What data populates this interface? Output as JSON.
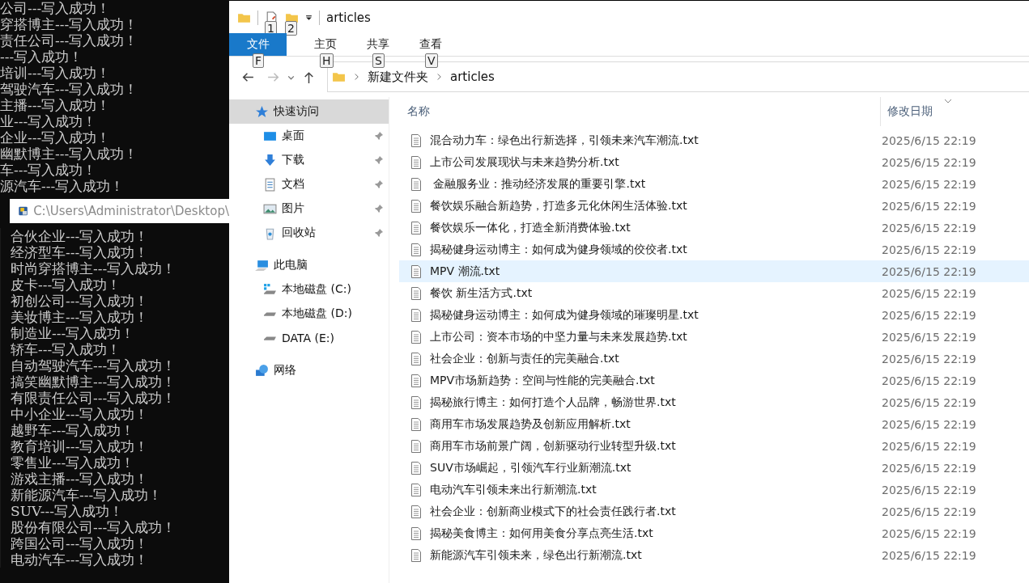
{
  "console": {
    "lines_top": [
      "公司---写入成功！",
      "穿搭博主---写入成功！",
      "责任公司---写入成功！",
      "---写入成功！",
      "培训---写入成功！",
      "驾驶汽车---写入成功！",
      "主播---写入成功！",
      "业---写入成功！",
      "企业---写入成功！",
      "幽默博主---写入成功！",
      "车---写入成功！",
      "源汽车---写入成功！"
    ],
    "popup_path": "C:\\Users\\Administrator\\Desktop\\",
    "lines_bottom": [
      "合伙企业---写入成功！",
      "经济型车---写入成功！",
      "时尚穿搭博主---写入成功！",
      "皮卡---写入成功！",
      "初创公司---写入成功！",
      "美妆博主---写入成功！",
      "制造业---写入成功！",
      "轿车---写入成功！",
      "自动驾驶汽车---写入成功！",
      "搞笑幽默博主---写入成功！",
      "有限责任公司---写入成功！",
      "中小企业---写入成功！",
      "越野车---写入成功！",
      "教育培训---写入成功！",
      "零售业---写入成功！",
      "游戏主播---写入成功！",
      "新能源汽车---写入成功！",
      "SUV---写入成功！",
      "股份有限公司---写入成功！",
      "跨国公司---写入成功！",
      "电动汽车---写入成功！"
    ]
  },
  "window": {
    "title": "articles",
    "quick_access_keytips": [
      "1",
      "2"
    ]
  },
  "ribbon_tabs": [
    {
      "label": "文件",
      "keytip": "F",
      "selected": true
    },
    {
      "label": "主页",
      "keytip": "H",
      "selected": false
    },
    {
      "label": "共享",
      "keytip": "S",
      "selected": false
    },
    {
      "label": "查看",
      "keytip": "V",
      "selected": false
    }
  ],
  "address": {
    "path": [
      "新建文件夹",
      "articles"
    ]
  },
  "nav": [
    {
      "label": "快速访问",
      "kind": "star",
      "selected": true,
      "children": [
        {
          "label": "桌面",
          "kind": "desktop",
          "pinned": true,
          "selected": false
        },
        {
          "label": "下载",
          "kind": "download",
          "pinned": true,
          "selected": false
        },
        {
          "label": "文档",
          "kind": "document",
          "pinned": true,
          "selected": false
        },
        {
          "label": "图片",
          "kind": "picture",
          "pinned": true,
          "selected": false
        },
        {
          "label": "回收站",
          "kind": "recycle",
          "pinned": true,
          "selected": false
        }
      ]
    },
    {
      "label": "此电脑",
      "kind": "computer",
      "selected": false,
      "children": [
        {
          "label": "本地磁盘 (C:)",
          "kind": "system-drive",
          "pinned": false,
          "selected": false
        },
        {
          "label": "本地磁盘 (D:)",
          "kind": "drive",
          "pinned": false,
          "selected": false
        },
        {
          "label": "DATA (E:)",
          "kind": "drive",
          "pinned": false,
          "selected": false
        }
      ]
    },
    {
      "label": "网络",
      "kind": "network",
      "selected": false
    }
  ],
  "columns": [
    "名称",
    "修改日期"
  ],
  "files": [
    {
      "name": "混合动力车：绿色出行新选择，引领未来汽车潮流.txt",
      "modified": "2025/6/15 22:19",
      "selected": false
    },
    {
      "name": "上市公司发展现状与未来趋势分析.txt",
      "modified": "2025/6/15 22:19",
      "selected": false
    },
    {
      "name": " 金融服务业：推动经济发展的重要引擎.txt",
      "modified": "2025/6/15 22:19",
      "selected": false
    },
    {
      "name": "餐饮娱乐融合新趋势，打造多元化休闲生活体验.txt",
      "modified": "2025/6/15 22:19",
      "selected": false
    },
    {
      "name": "餐饮娱乐一体化，打造全新消费体验.txt",
      "modified": "2025/6/15 22:19",
      "selected": false
    },
    {
      "name": "揭秘健身运动博主：如何成为健身领域的佼佼者.txt",
      "modified": "2025/6/15 22:19",
      "selected": false
    },
    {
      "name": "MPV 潮流.txt",
      "modified": "2025/6/15 22:19",
      "selected": true
    },
    {
      "name": "餐饮 新生活方式.txt",
      "modified": "2025/6/15 22:19",
      "selected": false
    },
    {
      "name": "揭秘健身运动博主：如何成为健身领域的璀璨明星.txt",
      "modified": "2025/6/15 22:19",
      "selected": false
    },
    {
      "name": "上市公司：资本市场的中坚力量与未来发展趋势.txt",
      "modified": "2025/6/15 22:19",
      "selected": false
    },
    {
      "name": "社会企业：创新与责任的完美融合.txt",
      "modified": "2025/6/15 22:19",
      "selected": false
    },
    {
      "name": "MPV市场新趋势：空间与性能的完美融合.txt",
      "modified": "2025/6/15 22:19",
      "selected": false
    },
    {
      "name": "揭秘旅行博主：如何打造个人品牌，畅游世界.txt",
      "modified": "2025/6/15 22:19",
      "selected": false
    },
    {
      "name": "商用车市场发展趋势及创新应用解析.txt",
      "modified": "2025/6/15 22:19",
      "selected": false
    },
    {
      "name": "商用车市场前景广阔，创新驱动行业转型升级.txt",
      "modified": "2025/6/15 22:19",
      "selected": false
    },
    {
      "name": "SUV市场崛起，引领汽车行业新潮流.txt",
      "modified": "2025/6/15 22:19",
      "selected": false
    },
    {
      "name": "电动汽车引领未来出行新潮流.txt",
      "modified": "2025/6/15 22:19",
      "selected": false
    },
    {
      "name": "社会企业：创新商业模式下的社会责任践行者.txt",
      "modified": "2025/6/15 22:19",
      "selected": false
    },
    {
      "name": "揭秘美食博主：如何用美食分享点亮生活.txt",
      "modified": "2025/6/15 22:19",
      "selected": false
    },
    {
      "name": "新能源汽车引领未来，绿色出行新潮流.txt",
      "modified": "2025/6/15 22:19",
      "selected": false
    }
  ]
}
